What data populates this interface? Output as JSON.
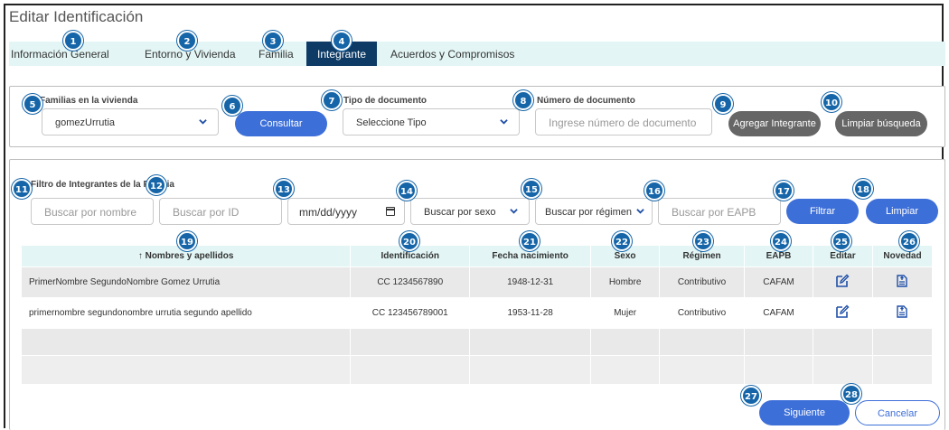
{
  "window": {
    "title": "Editar Identificación"
  },
  "tabs": [
    {
      "label": "Información General"
    },
    {
      "label": "Entorno y Vivienda"
    },
    {
      "label": "Familia"
    },
    {
      "label": "Integrante"
    },
    {
      "label": "Acuerdos y Compromisos"
    }
  ],
  "search": {
    "familias_label": "Familias en la vivienda",
    "familias_value": "gomezUrrutia",
    "consultar_label": "Consultar",
    "tipo_doc_label": "Tipo de documento",
    "tipo_doc_value": "Seleccione Tipo",
    "num_doc_label": "Número de documento",
    "num_doc_placeholder": "Ingrese número de documento",
    "agregar_label": "Agregar Integrante",
    "limpiar_busqueda_label": "Limpiar búsqueda"
  },
  "filter": {
    "title": "Filtro de Integrantes de la Familia",
    "nombre_placeholder": "Buscar por nombre",
    "id_placeholder": "Buscar por ID",
    "date_placeholder": "mm/dd/yyyy",
    "sexo_value": "Buscar por sexo",
    "regimen_value": "Buscar por régimen",
    "eapb_placeholder": "Buscar por EAPB",
    "filtrar_label": "Filtrar",
    "limpiar_label": "Limpiar"
  },
  "table": {
    "headers": {
      "nombres": "↑ Nombres y apellidos",
      "identificacion": "Identificación",
      "fecha": "Fecha nacimiento",
      "sexo": "Sexo",
      "regimen": "Régimen",
      "eapb": "EAPB",
      "editar": "Editar",
      "novedad": "Novedad"
    },
    "rows": [
      {
        "nombre": "PrimerNombre SegundoNombre Gomez Urrutia",
        "id": "CC 1234567890",
        "fecha": "1948-12-31",
        "sexo": "Hombre",
        "regimen": "Contributivo",
        "eapb": "CAFAM"
      },
      {
        "nombre": "primernombre segundonombre urrutia segundo apellido",
        "id": "CC 123456789001",
        "fecha": "1953-11-28",
        "sexo": "Mujer",
        "regimen": "Contributivo",
        "eapb": "CAFAM"
      }
    ]
  },
  "footer": {
    "siguiente_label": "Siguiente",
    "cancelar_label": "Cancelar"
  },
  "badges": [
    "1",
    "2",
    "3",
    "4",
    "5",
    "6",
    "7",
    "8",
    "9",
    "10",
    "11",
    "12",
    "13",
    "14",
    "15",
    "16",
    "17",
    "18",
    "19",
    "20",
    "21",
    "22",
    "23",
    "24",
    "25",
    "26",
    "27",
    "28"
  ],
  "colors": {
    "accent": "#3d6fd8",
    "tab_active": "#0d3b66",
    "tab_bar": "#e3f6f5",
    "badge": "#1565a8",
    "gray_button": "#666666"
  }
}
